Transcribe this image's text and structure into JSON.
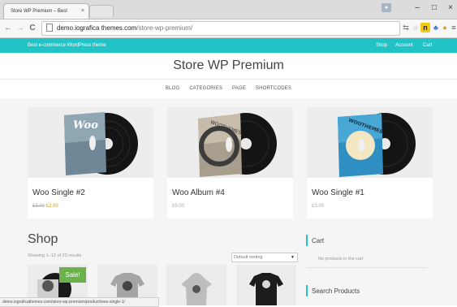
{
  "browser": {
    "tab_title": "Store WP Premium – Best",
    "tab_close": "×",
    "win_min": "–",
    "win_max": "□",
    "win_close": "×",
    "back": "←",
    "forward": "→",
    "reload": "C",
    "url_host": "demo.iografica themes.com",
    "url_path": "/store-wp-premium/",
    "status_url": "demo.iograficathemes.com/store-wp-premium/product/woo-single-1/"
  },
  "site": {
    "tagline": "Best e-commerce WordPress theme",
    "top_links": [
      "Shop",
      "Account",
      "Cart"
    ],
    "title": "Store WP Premium",
    "menu": [
      "BLOG",
      "CATEGORIES",
      "PAGE",
      "SHORTCODES"
    ]
  },
  "featured": [
    {
      "title": "Woo Single #2",
      "old_price": "£3.00",
      "price": "£2.00",
      "cover_text": "Woo"
    },
    {
      "title": "Woo Album #4",
      "old_price": "",
      "price": "£9.00",
      "cover_text": "WOOTHEMES"
    },
    {
      "title": "Woo Single #1",
      "old_price": "",
      "price": "£3.00",
      "cover_text": "WOOTHEMES"
    }
  ],
  "shop": {
    "title": "Shop",
    "showing": "Showing 1–12 of 23 results",
    "sorting": "Default sorting",
    "sale_badge": "Sale!"
  },
  "sidebar": {
    "cart_title": "Cart",
    "cart_empty": "No products in the cart.",
    "search_title": "Search Products"
  },
  "colors": {
    "accent": "#22c3c7",
    "sale": "#6ab04c",
    "sale_price": "#d0a31b"
  }
}
